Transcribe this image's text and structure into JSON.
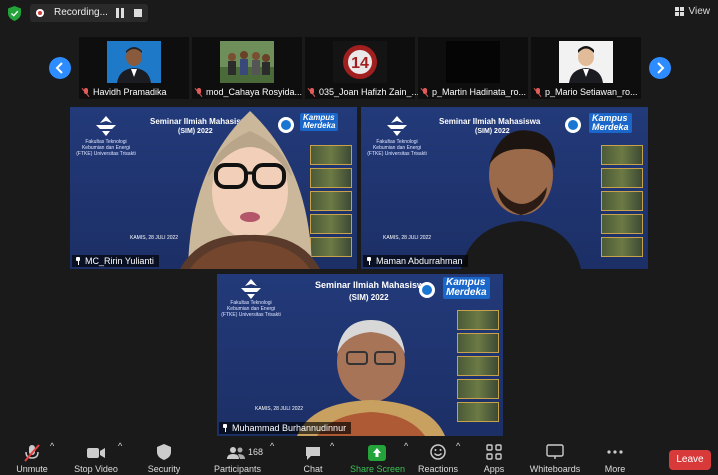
{
  "top_bar": {
    "recording_label": "Recording...",
    "view_label": "View"
  },
  "gallery_strip": [
    {
      "name": "Havidh Pramadika"
    },
    {
      "name": "mod_Cahaya Rosyida..."
    },
    {
      "name": "035_Joan Hafizh Zain_..."
    },
    {
      "name": "p_Martin Hadinata_ro..."
    },
    {
      "name": "p_Mario Setiawan_ro..."
    }
  ],
  "main_tiles": [
    {
      "name": "MC_Ririn Yulianti",
      "active_speaker": true
    },
    {
      "name": "Maman Abdurrahman",
      "active_speaker": false
    },
    {
      "name": "Muhammad Burhannudinnur",
      "active_speaker": false
    }
  ],
  "slide": {
    "title": "Seminar Ilmiah Mahasiswa",
    "subtitle": "(SIM) 2022",
    "faculty": "Fakultas Teknologi Kebumian dan Energi (FTKE) Universitas Trisakti",
    "kampus_line1": "Kampus",
    "kampus_line2": "Merdeka",
    "date": "KAMIS, 28 JULI 2022"
  },
  "toolbar": {
    "unmute": "Unmute",
    "stop_video": "Stop Video",
    "security": "Security",
    "participants": "Participants",
    "participants_count": "168",
    "chat": "Chat",
    "share_screen": "Share Screen",
    "reactions": "Reactions",
    "apps": "Apps",
    "whiteboards": "Whiteboards",
    "more": "More",
    "leave": "Leave"
  },
  "colors": {
    "accent_blue": "#2d8cff",
    "active_border": "#e8e76b",
    "share_green": "#23a33a",
    "leave_red": "#d83a3a"
  }
}
